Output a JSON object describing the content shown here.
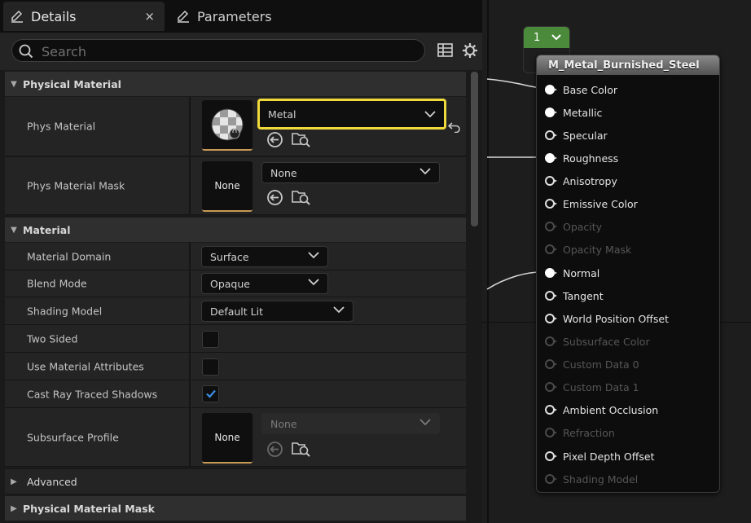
{
  "tabs": {
    "details_label": "Details",
    "close_glyph": "×",
    "parameters_label": "Parameters"
  },
  "search": {
    "placeholder": "Search"
  },
  "categories": {
    "physical_material": "Physical Material",
    "material": "Material",
    "advanced": "Advanced",
    "physical_material_mask": "Physical Material Mask"
  },
  "properties": {
    "phys_material": {
      "label": "Phys Material",
      "value": "Metal"
    },
    "phys_material_mask": {
      "label": "Phys Material Mask",
      "value": "None",
      "thumb": "None"
    },
    "material_domain": {
      "label": "Material Domain",
      "value": "Surface"
    },
    "blend_mode": {
      "label": "Blend Mode",
      "value": "Opaque"
    },
    "shading_model": {
      "label": "Shading Model",
      "value": "Default Lit"
    },
    "two_sided": {
      "label": "Two Sided",
      "checked": false
    },
    "use_material_attributes": {
      "label": "Use Material Attributes",
      "checked": false
    },
    "cast_ray_traced_shadows": {
      "label": "Cast Ray Traced Shadows",
      "checked": true
    },
    "subsurface_profile": {
      "label": "Subsurface Profile",
      "value": "None",
      "thumb": "None"
    }
  },
  "graph": {
    "pill_label": "1",
    "node_title": "M_Metal_Burnished_Steel",
    "pins": [
      {
        "label": "Base Color",
        "state": "connected"
      },
      {
        "label": "Metallic",
        "state": "connected"
      },
      {
        "label": "Specular",
        "state": "open"
      },
      {
        "label": "Roughness",
        "state": "connected"
      },
      {
        "label": "Anisotropy",
        "state": "open"
      },
      {
        "label": "Emissive Color",
        "state": "open"
      },
      {
        "label": "Opacity",
        "state": "dim"
      },
      {
        "label": "Opacity Mask",
        "state": "dim"
      },
      {
        "label": "Normal",
        "state": "connected"
      },
      {
        "label": "Tangent",
        "state": "open"
      },
      {
        "label": "World Position Offset",
        "state": "open"
      },
      {
        "label": "Subsurface Color",
        "state": "dim"
      },
      {
        "label": "Custom Data 0",
        "state": "dim"
      },
      {
        "label": "Custom Data 1",
        "state": "dim"
      },
      {
        "label": "Ambient Occlusion",
        "state": "open"
      },
      {
        "label": "Refraction",
        "state": "dim"
      },
      {
        "label": "Pixel Depth Offset",
        "state": "open"
      },
      {
        "label": "Shading Model",
        "state": "dim"
      }
    ]
  },
  "colors": {
    "focus_outline": "#f0d93a",
    "pill_green": "#4b8a3a",
    "checkbox_check": "#3a8ee6",
    "thumb_underline": "#c89a55"
  }
}
